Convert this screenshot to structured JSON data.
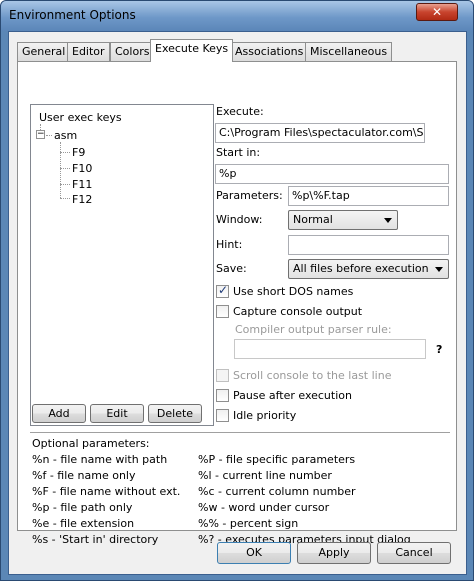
{
  "window": {
    "title": "Environment Options",
    "close_glyph": "✕"
  },
  "tabs": [
    {
      "label": "General"
    },
    {
      "label": "Editor"
    },
    {
      "label": "Colors"
    },
    {
      "label": "Execute Keys",
      "active": true
    },
    {
      "label": "Associations"
    },
    {
      "label": "Miscellaneous"
    }
  ],
  "tree": {
    "root": "User exec keys",
    "expander": "−",
    "node": "asm",
    "children": [
      "F9",
      "F10",
      "F11",
      "F12"
    ]
  },
  "tree_buttons": {
    "add": "Add",
    "edit": "Edit",
    "delete": "Delete"
  },
  "form": {
    "execute_label": "Execute:",
    "execute_value": "C:\\Program Files\\spectaculator.com\\Spect",
    "startin_label": "Start in:",
    "startin_value": "%p",
    "parameters_label": "Parameters:",
    "parameters_value": "%p\\%F.tap",
    "window_label": "Window:",
    "window_value": "Normal",
    "hint_label": "Hint:",
    "hint_value": "",
    "save_label": "Save:",
    "save_value": "All files before execution",
    "use_short_dos": "Use short DOS names",
    "capture_console": "Capture console output",
    "parser_rule_label": "Compiler output parser rule:",
    "parser_rule_value": "",
    "parser_help": "?",
    "scroll_console": "Scroll console to the last line",
    "pause_after": "Pause after execution",
    "idle_priority": "Idle priority",
    "checked_glyph": "✓"
  },
  "params_heading": "Optional parameters:",
  "params_left": [
    "%n  - file name with path",
    "%f   - file name only",
    "%F  - file name without ext.",
    "%p  - file path only",
    "%e  - file extension",
    "%s  - 'Start in' directory"
  ],
  "params_right": [
    "%P  - file specific parameters",
    "%l   - current line number",
    "%c  - current column number",
    "%w  - word under cursor",
    "%%  - percent sign",
    "%?  - executes parameters input dialog"
  ],
  "dialog_buttons": {
    "ok": "OK",
    "apply": "Apply",
    "cancel": "Cancel"
  }
}
